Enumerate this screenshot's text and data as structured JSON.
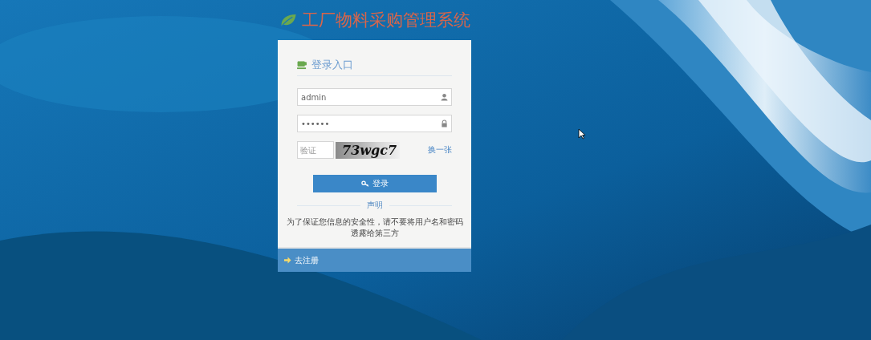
{
  "title": "工厂物料采购管理系统",
  "login": {
    "heading": "登录入口",
    "username": {
      "value": "admin"
    },
    "password": {
      "value": "••••••"
    },
    "captcha": {
      "placeholder": "验证",
      "code": "73wgc7",
      "refresh": "换一张"
    },
    "submit": "登录",
    "notice_title": "声明",
    "notice": "为了保证您信息的安全性，请不要将用户名和密码透露给第三方"
  },
  "footer": {
    "link": "去注册"
  }
}
